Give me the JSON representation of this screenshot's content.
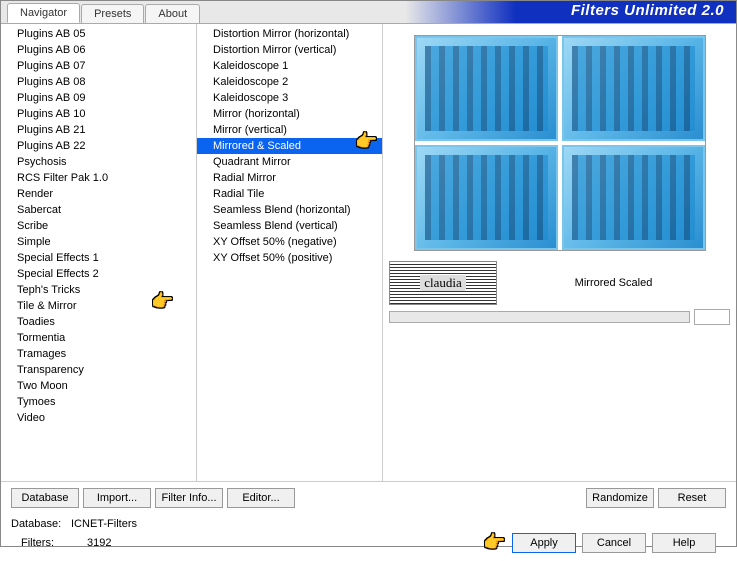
{
  "app": {
    "title": "Filters Unlimited 2.0",
    "tabs": [
      "Navigator",
      "Presets",
      "About"
    ],
    "active_tab": 0
  },
  "categories": {
    "items": [
      "Plugins AB 05",
      "Plugins AB 06",
      "Plugins AB 07",
      "Plugins AB 08",
      "Plugins AB 09",
      "Plugins AB 10",
      "Plugins AB 21",
      "Plugins AB 22",
      "Psychosis",
      "RCS Filter Pak 1.0",
      "Render",
      "Sabercat",
      "Scribe",
      "Simple",
      "Special Effects 1",
      "Special Effects 2",
      "Teph's Tricks",
      "Tile & Mirror",
      "Toadies",
      "Tormentia",
      "Tramages",
      "Transparency",
      "Two Moon",
      "Tymoes",
      "Video"
    ],
    "selected_index": 17
  },
  "filters": {
    "items": [
      "Distortion Mirror (horizontal)",
      "Distortion Mirror (vertical)",
      "Kaleidoscope 1",
      "Kaleidoscope 2",
      "Kaleidoscope 3",
      "Mirror (horizontal)",
      "Mirror (vertical)",
      "Mirrored & Scaled",
      "Quadrant Mirror",
      "Radial Mirror",
      "Radial Tile",
      "Seamless Blend (horizontal)",
      "Seamless Blend (vertical)",
      "XY Offset 50% (negative)",
      "XY Offset 50% (positive)"
    ],
    "selected_index": 7
  },
  "params": {
    "logo_text": "claudia",
    "name": "Mirrored Scaled",
    "slider_value": ""
  },
  "buttons": {
    "database": "Database",
    "import": "Import...",
    "filter_info": "Filter Info...",
    "editor": "Editor...",
    "randomize": "Randomize",
    "reset": "Reset",
    "apply": "Apply",
    "cancel": "Cancel",
    "help": "Help"
  },
  "status": {
    "db_label": "Database:",
    "db_value": "ICNET-Filters",
    "filters_label": "Filters:",
    "filters_value": "3192"
  },
  "pointer_glyph": "👈"
}
